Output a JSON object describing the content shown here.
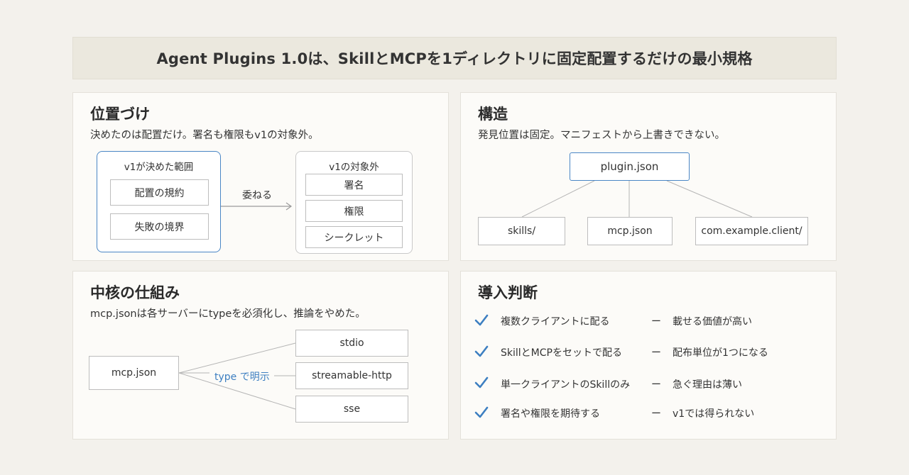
{
  "header": {
    "title": "Agent Plugins 1.0は、SkillとMCPを1ディレクトリに固定配置するだけの最小規格"
  },
  "positioning": {
    "title": "位置づけ",
    "subtitle": "決めたのは配置だけ。署名も権限もv1の対象外。",
    "decided": {
      "label": "v1が決めた範囲",
      "items": [
        "配置の規約",
        "失敗の境界"
      ]
    },
    "arrow_label": "委ねる",
    "excluded": {
      "label": "v1の対象外",
      "items": [
        "署名",
        "権限",
        "シークレット"
      ]
    }
  },
  "structure": {
    "title": "構造",
    "subtitle": "発見位置は固定。マニフェストから上書きできない。",
    "root": "plugin.json",
    "children": [
      "skills/",
      "mcp.json",
      "com.example.client/"
    ]
  },
  "core": {
    "title": "中核の仕組み",
    "subtitle": "mcp.jsonは各サーバーにtypeを必須化し、推論をやめた。",
    "source": "mcp.json",
    "edge_label": "type で明示",
    "targets": [
      "stdio",
      "streamable-http",
      "sse"
    ]
  },
  "decision": {
    "title": "導入判断",
    "rows": [
      {
        "case": "複数クライアントに配る",
        "dash": "ー",
        "result": "載せる価値が高い"
      },
      {
        "case": "SkillとMCPをセットで配る",
        "dash": "ー",
        "result": "配布単位が1つになる"
      },
      {
        "case": "単一クライアントのSkillのみ",
        "dash": "ー",
        "result": "急ぐ理由は薄い"
      },
      {
        "case": "署名や権限を期待する",
        "dash": "ー",
        "result": "v1では得られない"
      }
    ]
  },
  "colors": {
    "accent": "#4a86c5",
    "check": "#3d7fc1",
    "background": "#f3f1ec"
  }
}
